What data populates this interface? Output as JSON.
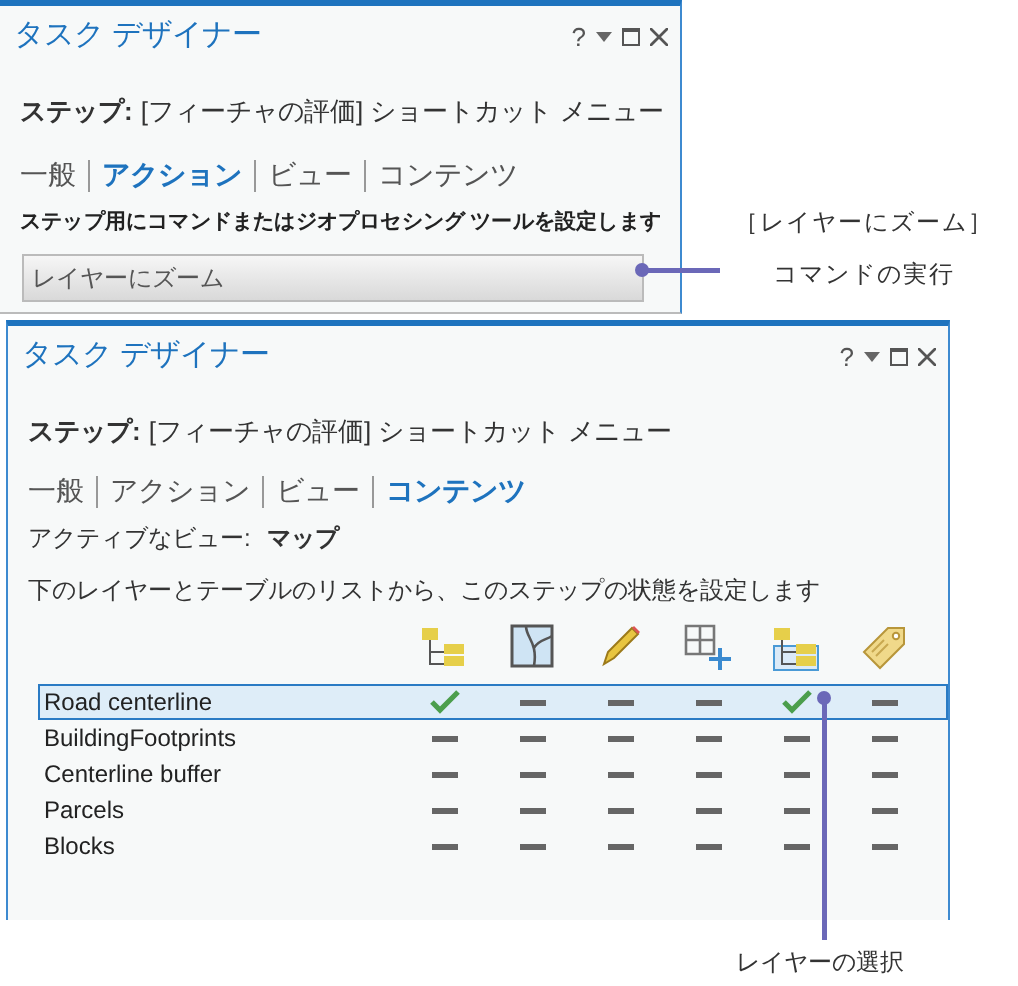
{
  "panels": [
    {
      "title": "タスク デザイナー",
      "help": "?",
      "step_label": "ステップ:",
      "step_value": "[フィーチャの評価] ショートカット メニュー",
      "tabs": [
        {
          "label": "一般",
          "selected": false
        },
        {
          "label": "アクション",
          "selected": true
        },
        {
          "label": "ビュー",
          "selected": false
        },
        {
          "label": "コンテンツ",
          "selected": false
        }
      ],
      "kind": "action",
      "description": "ステップ用にコマンドまたはジオプロセシング ツールを設定します",
      "command": "レイヤーにズーム"
    },
    {
      "title": "タスク デザイナー",
      "help": "?",
      "step_label": "ステップ:",
      "step_value": "[フィーチャの評価] ショートカット メニュー",
      "tabs": [
        {
          "label": "一般",
          "selected": false
        },
        {
          "label": "アクション",
          "selected": false
        },
        {
          "label": "ビュー",
          "selected": false
        },
        {
          "label": "コンテンツ",
          "selected": true
        }
      ],
      "kind": "contents",
      "active_view_label": "アクティブなビュー:",
      "active_view": "マップ",
      "description": "下のレイヤーとテーブルのリストから、このステップの状態を設定します",
      "layers": [
        {
          "name": "Road centerline",
          "selected": true,
          "states": [
            {
              "checked": true
            },
            {
              "checked": false
            },
            {
              "checked": false
            },
            {
              "checked": false
            },
            {
              "checked": true
            },
            {
              "checked": false
            }
          ]
        },
        {
          "name": "BuildingFootprints",
          "selected": false,
          "states": [
            {
              "checked": false
            },
            {
              "checked": false
            },
            {
              "checked": false
            },
            {
              "checked": false
            },
            {
              "checked": false
            },
            {
              "checked": false
            }
          ]
        },
        {
          "name": "Centerline buffer",
          "selected": false,
          "states": [
            {
              "checked": false
            },
            {
              "checked": false
            },
            {
              "checked": false
            },
            {
              "checked": false
            },
            {
              "checked": false
            },
            {
              "checked": false
            }
          ]
        },
        {
          "name": "Parcels",
          "selected": false,
          "states": [
            {
              "checked": false
            },
            {
              "checked": false
            },
            {
              "checked": false
            },
            {
              "checked": false
            },
            {
              "checked": false
            },
            {
              "checked": false
            }
          ]
        },
        {
          "name": "Blocks",
          "selected": false,
          "states": [
            {
              "checked": false
            },
            {
              "checked": false
            },
            {
              "checked": false
            },
            {
              "checked": false
            },
            {
              "checked": false
            },
            {
              "checked": false
            }
          ]
        }
      ]
    }
  ],
  "callouts": [
    {
      "lines": [
        "［レイヤーにズーム］",
        "コマンドの実行"
      ]
    },
    {
      "lines": [
        "レイヤーの選択"
      ]
    }
  ]
}
